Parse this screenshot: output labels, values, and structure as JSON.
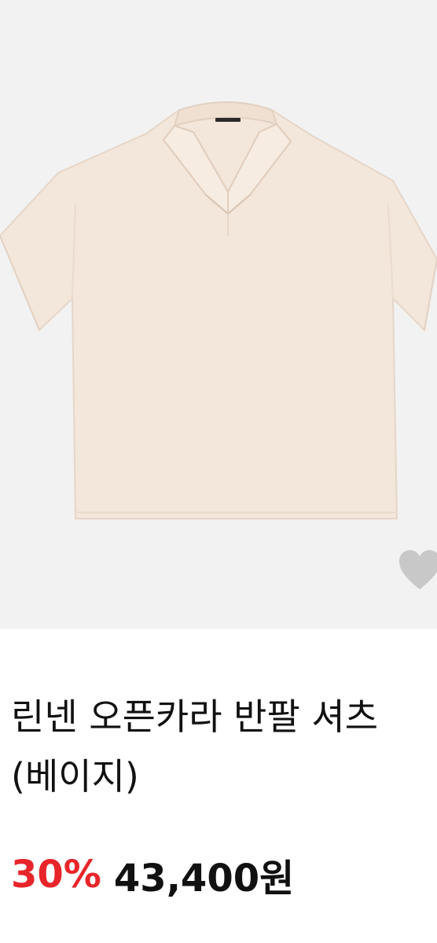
{
  "product": {
    "image_alt": "beige linen open-collar short-sleeve shirt",
    "title": "린넨 오픈카라 반팔 셔츠 (베이지)",
    "discount": "30%",
    "price": "43,400원"
  },
  "icons": {
    "wishlist": "heart-icon"
  },
  "colors": {
    "image_background": "#f2f2f2",
    "shirt": "#f3e6da",
    "discount": "#e8252a",
    "text": "#111111",
    "heart": "#c8c8c8"
  }
}
